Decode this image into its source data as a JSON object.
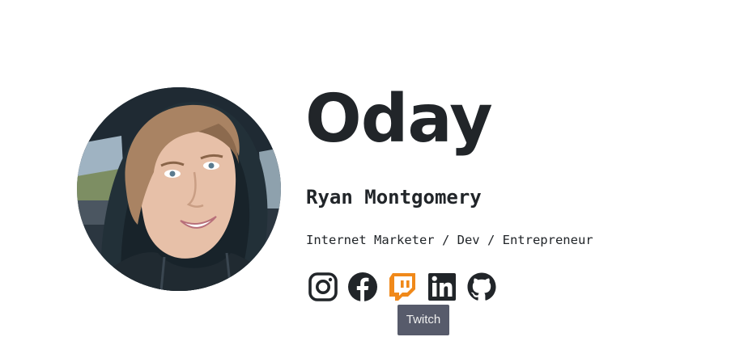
{
  "profile": {
    "heading": "Oday",
    "name": "Ryan Montgomery",
    "tagline": "Internet Marketer / Dev / Entrepreneur",
    "avatar_alt": "profile photo"
  },
  "socials": [
    {
      "name": "instagram-icon",
      "color": "#212529"
    },
    {
      "name": "facebook-icon",
      "color": "#212529"
    },
    {
      "name": "twitch-icon",
      "color": "#f0891a",
      "hovered": true
    },
    {
      "name": "linkedin-icon",
      "color": "#212529"
    },
    {
      "name": "github-icon",
      "color": "#212529"
    }
  ],
  "tooltip": {
    "text": "Twitch"
  },
  "colors": {
    "text": "#212529",
    "twitch_hover": "#f0891a",
    "tooltip_bg": "#575b6b"
  }
}
